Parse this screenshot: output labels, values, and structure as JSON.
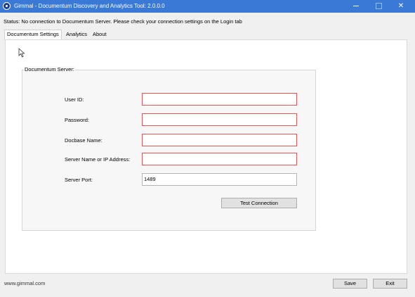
{
  "window": {
    "title": "Gimmal - Documentum Discovery and Analytics Tool: 2.0.0.0",
    "icon": "gimmal-app-icon",
    "controls": [
      "minimize-icon",
      "maximize-icon",
      "close-icon"
    ],
    "close_glyph": "✕"
  },
  "status": {
    "text": "Status:  No connection to Documentum Server. Please check your connection settings on the Login tab"
  },
  "tabs": [
    {
      "label": "Documentum Settings",
      "active": true
    },
    {
      "label": "Analytics",
      "active": false
    },
    {
      "label": "About",
      "active": false
    }
  ],
  "server_group": {
    "title": "Documentum Server:",
    "fields": [
      {
        "label": "User ID:",
        "value": "",
        "valid": false
      },
      {
        "label": "Password:",
        "value": "",
        "valid": false
      },
      {
        "label": "Docbase Name:",
        "value": "",
        "valid": false
      },
      {
        "label": "Server Name or IP Address:",
        "value": "",
        "valid": false
      },
      {
        "label": "Server Port:",
        "value": "1489",
        "valid": true
      }
    ],
    "test_button": "Test Connection"
  },
  "footer": {
    "link": "www.gimmal.com",
    "save_label": "Save",
    "exit_label": "Exit"
  },
  "colors": {
    "titlebar": "#3a79d6",
    "invalid_border": "#e25858"
  }
}
